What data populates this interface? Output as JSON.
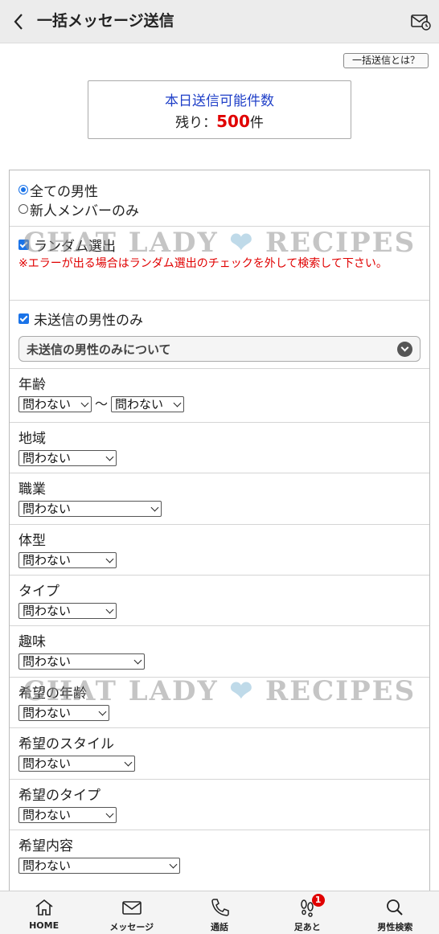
{
  "header": {
    "title": "一括メッセージ送信"
  },
  "help": {
    "label": "一括送信とは？"
  },
  "quota": {
    "title": "本日送信可能件数",
    "remain_prefix": "残り：",
    "remain_count": "500",
    "remain_unit": "件"
  },
  "target": {
    "options": [
      "全ての男性",
      "新人メンバーのみ"
    ],
    "selected": "全ての男性"
  },
  "random": {
    "label": "ランダム選出",
    "checked": true,
    "error": "※エラーが出る場合はランダム選出のチェックを外して検索して下さい。"
  },
  "unsent": {
    "label": "未送信の男性のみ",
    "checked": true,
    "about": "未送信の男性のみについて"
  },
  "filters": {
    "age": {
      "label": "年齢",
      "from": "問わない",
      "to": "問わない",
      "sep": "〜"
    },
    "area": {
      "label": "地域",
      "value": "問わない"
    },
    "job": {
      "label": "職業",
      "value": "問わない"
    },
    "body": {
      "label": "体型",
      "value": "問わない"
    },
    "type": {
      "label": "タイプ",
      "value": "問わない"
    },
    "hobby": {
      "label": "趣味",
      "value": "問わない"
    },
    "pref_age": {
      "label": "希望の年齢",
      "value": "問わない"
    },
    "pref_style": {
      "label": "希望のスタイル",
      "value": "問わない"
    },
    "pref_type": {
      "label": "希望のタイプ",
      "value": "問わない"
    },
    "pref_content": {
      "label": "希望内容",
      "value": "問わない"
    }
  },
  "watermark": {
    "left": "CHAT LADY",
    "right": "RECIPES"
  },
  "tabs": [
    {
      "label": "HOME",
      "icon": "home-icon"
    },
    {
      "label": "メッセージ",
      "icon": "mail-icon"
    },
    {
      "label": "通話",
      "icon": "phone-icon"
    },
    {
      "label": "足あと",
      "icon": "footprints-icon",
      "badge": "1"
    },
    {
      "label": "男性検索",
      "icon": "search-icon"
    }
  ],
  "colors": {
    "accent": "#1a73e8",
    "error": "#e00000",
    "quota_title": "#1f3fc8"
  }
}
